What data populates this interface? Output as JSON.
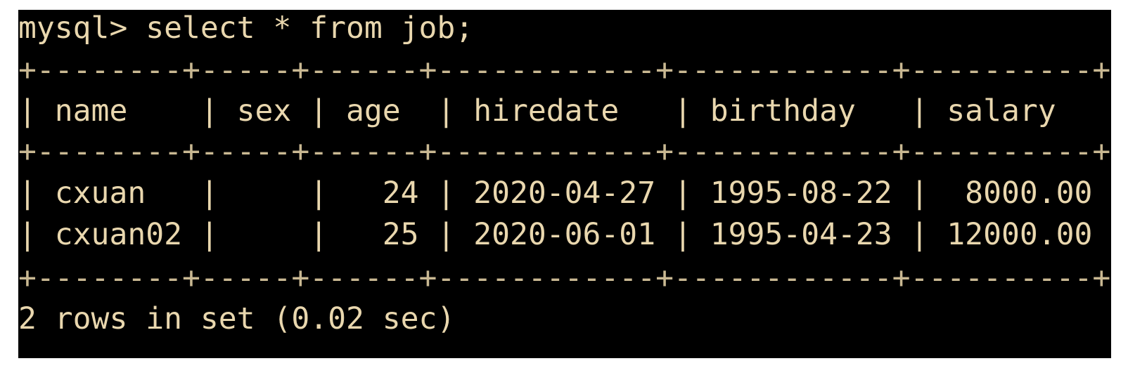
{
  "terminal": {
    "prompt_line": "mysql> select * from job;",
    "border": "+--------+-----+------+------------+------------+----------+",
    "header": "| name    | sex | age  | hiredate   | birthday   | salary   |",
    "rows": [
      "| cxuan   |     |   24 | 2020-04-27 | 1995-08-22 |  8000.00 |",
      "| cxuan02 |     |   25 | 2020-06-01 | 1995-04-23 | 12000.00 |"
    ],
    "status_line": "2 rows in set (0.02 sec)"
  },
  "colors": {
    "background": "#000000",
    "text": "#e9d7ae"
  }
}
